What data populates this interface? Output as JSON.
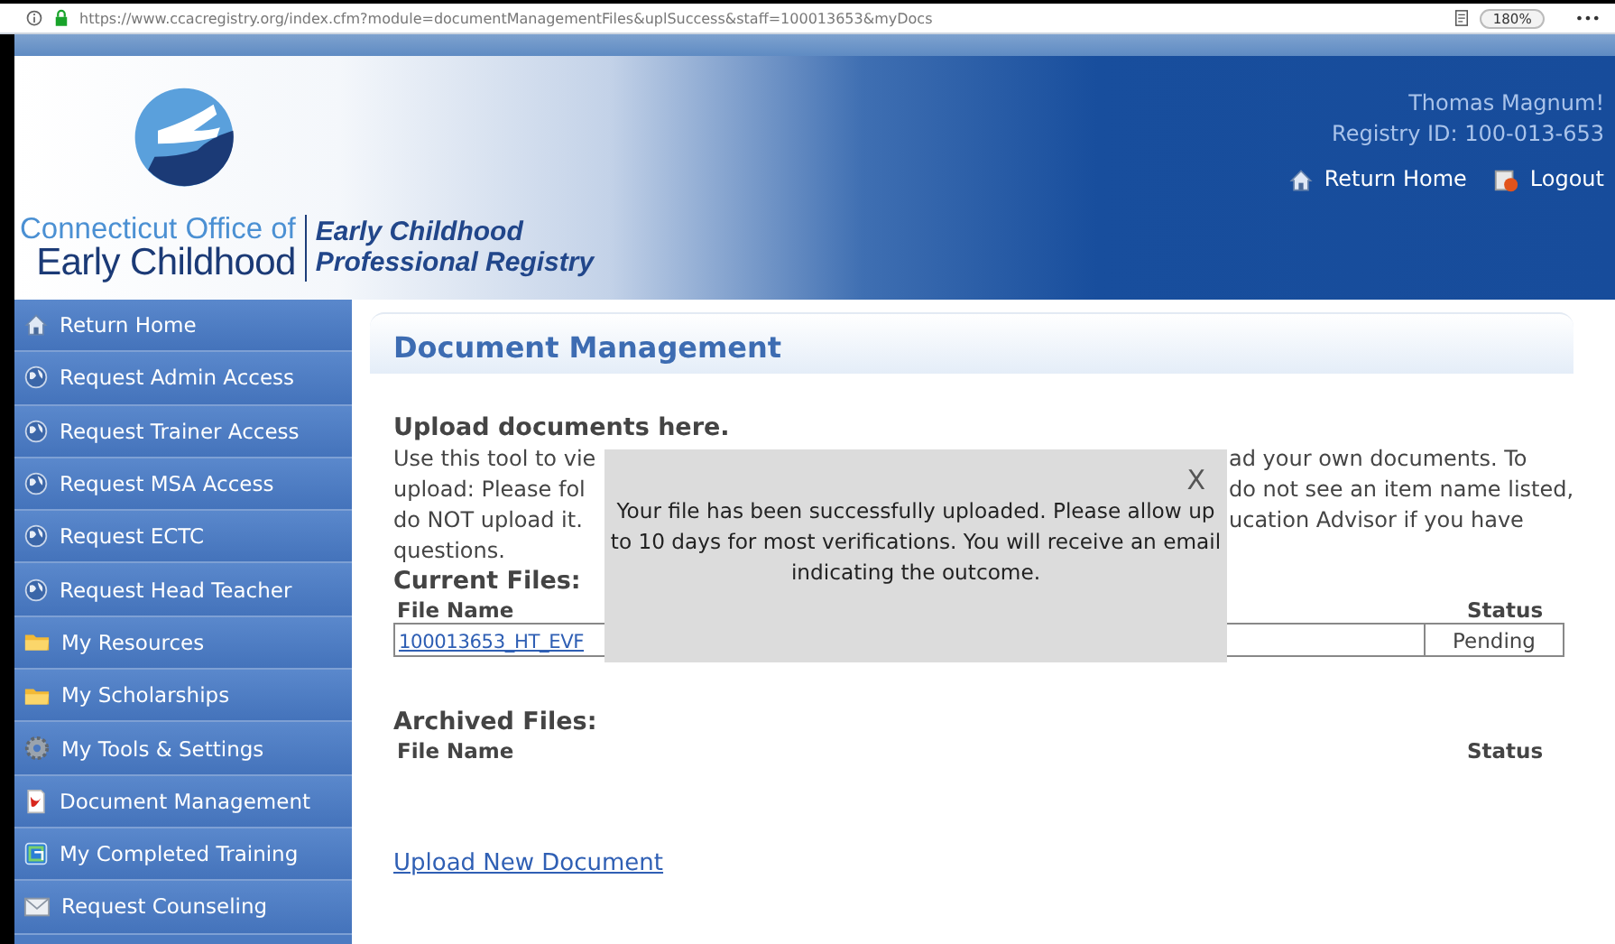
{
  "browser": {
    "url": "https://www.ccacregistry.org/index.cfm?module=documentManagementFiles&uplSuccess&staff=100013653&myDocs",
    "zoom": "180%",
    "menu": "•••"
  },
  "header": {
    "org_line1": "Connecticut Office of",
    "org_line2": "Early Childhood",
    "registry_line1": "Early Childhood",
    "registry_line2": "Professional Registry",
    "user_name": "Thomas Magnum!",
    "registry_id": "Registry ID: 100-013-653",
    "links": [
      {
        "label": "Return Home",
        "kind": "home"
      },
      {
        "label": "Logout",
        "kind": "logout"
      }
    ]
  },
  "sidebar": {
    "items": [
      {
        "label": "Return Home",
        "kind": "home"
      },
      {
        "label": "Request Admin Access",
        "kind": "globe"
      },
      {
        "label": "Request Trainer Access",
        "kind": "globe"
      },
      {
        "label": "Request MSA Access",
        "kind": "globe"
      },
      {
        "label": "Request ECTC",
        "kind": "globe"
      },
      {
        "label": "Request Head Teacher",
        "kind": "globe"
      },
      {
        "label": "My Resources",
        "kind": "folder"
      },
      {
        "label": "My Scholarships",
        "kind": "folder"
      },
      {
        "label": "My Tools & Settings",
        "kind": "gear"
      },
      {
        "label": "Document Management",
        "kind": "document"
      },
      {
        "label": "My Completed Training",
        "kind": "training"
      },
      {
        "label": "Request Counseling",
        "kind": "mail"
      }
    ]
  },
  "content": {
    "title": "Document Management",
    "upload_heading": "Upload documents here.",
    "intro_lines": [
      {
        "left": "Use this tool to vie",
        "right": "ad your own documents. To"
      },
      {
        "left": "upload: Please fol",
        "right": "do not see an item name listed,"
      },
      {
        "left": "do NOT upload it.",
        "right": "ucation Advisor if you have"
      },
      {
        "left": "questions."
      }
    ],
    "current_files": {
      "heading": "Current Files:",
      "columns": [
        "File Name",
        "Status"
      ],
      "rows": [
        {
          "file": "100013653_HT_EVF",
          "status": "Pending"
        }
      ]
    },
    "archived_files": {
      "heading": "Archived Files:",
      "columns": [
        "File Name",
        "Status"
      ]
    },
    "upload_link": "Upload New Document"
  },
  "modal": {
    "close": "X",
    "message": "Your file has been successfully uploaded. Please allow up to 10 days for most verifications. You will receive an email indicating the outcome."
  }
}
